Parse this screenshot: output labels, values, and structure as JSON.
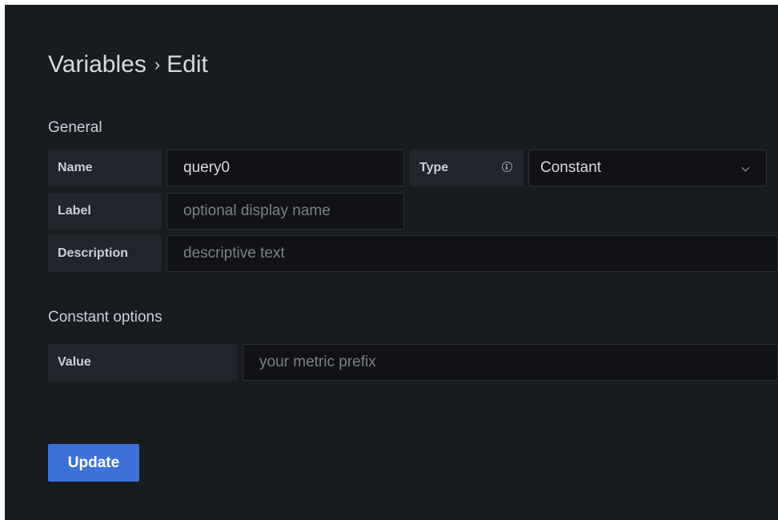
{
  "header": {
    "breadcrumb_parent": "Variables",
    "separator": "›",
    "breadcrumb_current": "Edit"
  },
  "general": {
    "section_title": "General",
    "name": {
      "label": "Name",
      "value": "query0"
    },
    "type": {
      "label": "Type",
      "info_icon": "info-icon",
      "selected": "Constant",
      "dropdown_icon": "chevron-down-icon"
    },
    "label": {
      "label": "Label",
      "value": "",
      "placeholder": "optional display name"
    },
    "description": {
      "label": "Description",
      "value": "",
      "placeholder": "descriptive text"
    }
  },
  "constant_options": {
    "section_title": "Constant options",
    "value": {
      "label": "Value",
      "value": "",
      "placeholder": "your metric prefix"
    }
  },
  "actions": {
    "update_label": "Update"
  },
  "colors": {
    "background": "#181b1f",
    "label_bg": "#22252b",
    "input_bg": "#111217",
    "primary": "#3d71d9"
  }
}
